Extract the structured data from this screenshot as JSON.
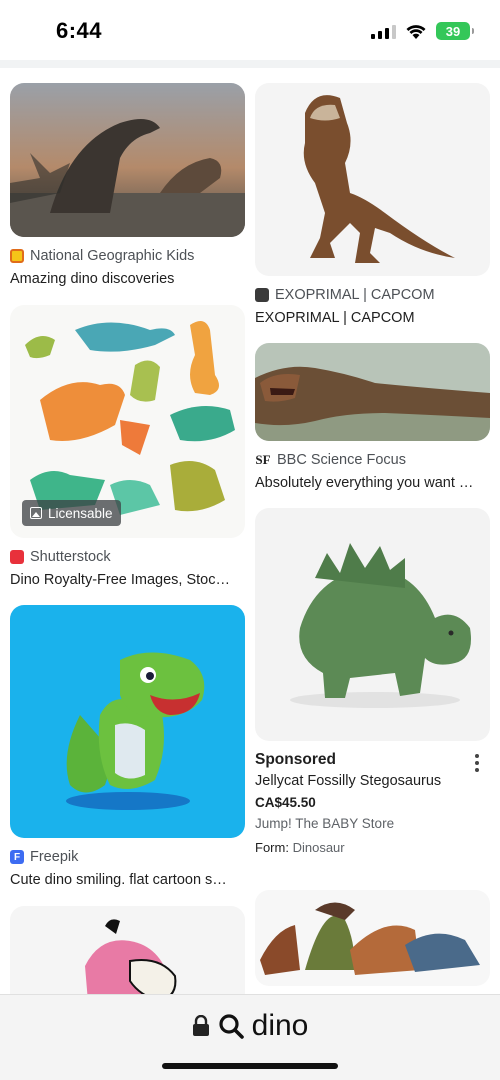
{
  "status_bar": {
    "time": "6:44",
    "battery": "39"
  },
  "results": [
    {
      "source": "National Geographic Kids",
      "title": "Amazing dino discoveries",
      "favicon_color": "#f5c518"
    },
    {
      "source": "EXOPRIMAL | CAPCOM",
      "title": "EXOPRIMAL | CAPCOM",
      "favicon_color": "#3a3a3a"
    },
    {
      "source": "BBC Science Focus",
      "title": "Absolutely everything you want …",
      "favicon_text": "SF"
    },
    {
      "source": "Shutterstock",
      "title": "Dino Royalty-Free Images, Stoc…",
      "favicon_color": "#e8313b",
      "badge": "Licensable"
    },
    {
      "source": "Freepik",
      "title": "Cute dino smiling. flat cartoon s…",
      "favicon_color": "#3d6cf2",
      "favicon_text": "F"
    }
  ],
  "sponsored": {
    "label": "Sponsored",
    "product": "Jellycat Fossilly Stegosaurus",
    "price": "CA$45.50",
    "store": "Jump! The BABY Store",
    "attr_label": "Form:",
    "attr_value": "Dinosaur"
  },
  "bottom_bar": {
    "query": "dino"
  },
  "icons": [
    "signal-icon",
    "wifi-icon",
    "battery-icon",
    "lock-icon",
    "search-icon",
    "more-options-icon",
    "image-icon"
  ]
}
